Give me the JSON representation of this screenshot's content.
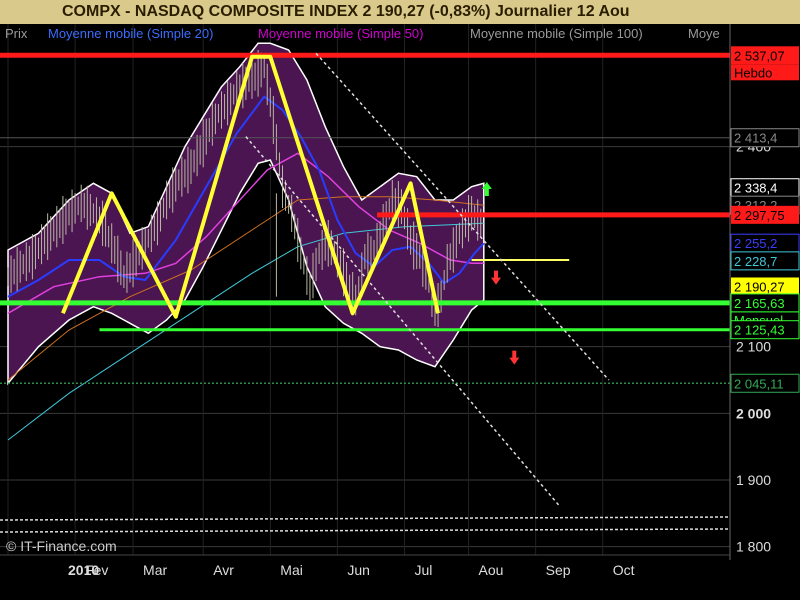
{
  "header": {
    "title": "COMPX - NASDAQ COMPOSITE INDEX    2 190,27 (-0,83%)    Journalier  12 Aou"
  },
  "legend": [
    {
      "text": "Prix",
      "color": "#9a9a9a"
    },
    {
      "text": "Moyenne mobile (Simple 20)",
      "color": "#3a6cff"
    },
    {
      "text": "Moyenne mobile (Simple 50)",
      "color": "#d000d0"
    },
    {
      "text": "Moyenne mobile (Simple 100)",
      "color": "#9a9a9a"
    },
    {
      "text": "Moye",
      "color": "#9a9a9a"
    }
  ],
  "watermark": "© IT-Finance.com",
  "colors": {
    "background": "#000000",
    "band_fill": "#4a1550",
    "zigzag": "#ffff33",
    "resistance": "#ff1a1a",
    "support": "#33ff33",
    "ma20": "#2a3cff",
    "ma50": "#e040e0",
    "ma100": "#d07020",
    "ma200": "#40c8d8",
    "trend_dashed": "#e0e0e0"
  },
  "chart_data": {
    "type": "line",
    "title": "COMPX - NASDAQ COMPOSITE INDEX",
    "ylim": [
      1780,
      2560
    ],
    "x_ticks": [
      "2010",
      "Fev",
      "Mar",
      "Avr",
      "Mai",
      "Jun",
      "Jul",
      "Aou",
      "Sep",
      "Oct"
    ],
    "x_tick_index": [
      0,
      22,
      41,
      64,
      86,
      108,
      130,
      151,
      173,
      195
    ],
    "y_ticks": [
      {
        "value": 2400,
        "label": "2 400"
      },
      {
        "value": 2100,
        "label": "2 100"
      },
      {
        "value": 2000,
        "label": "2 000"
      },
      {
        "value": 1900,
        "label": "1 900"
      },
      {
        "value": 1800,
        "label": "1 800"
      }
    ],
    "hline_labels": [
      {
        "value": 2537.07,
        "label": "2 537,07",
        "color": "#ff1a1a",
        "sub": "Hebdo"
      },
      {
        "value": 2413.4,
        "label": "2 413,4",
        "color": "#888888"
      },
      {
        "value": 2338.4,
        "label": "2 338,4",
        "color": "#ffffff"
      },
      {
        "value": 2312.2,
        "label": "2 312,2",
        "color": "#888888"
      },
      {
        "value": 2297.75,
        "label": "2 297,75",
        "color": "#ff1a1a"
      },
      {
        "value": 2255.2,
        "label": "2 255,2",
        "color": "#3a3cff"
      },
      {
        "value": 2228.7,
        "label": "2 228,7",
        "color": "#40c8d8"
      },
      {
        "value": 2190.27,
        "label": "2 190,27",
        "color": "#ffff00"
      },
      {
        "value": 2165.63,
        "label": "2 165,63",
        "color": "#33ff33",
        "sub": "Mensuel"
      },
      {
        "value": 2125.43,
        "label": "2 125,43",
        "color": "#33ff33"
      },
      {
        "value": 2045.11,
        "label": "2 045,11",
        "color": "#33aa55"
      }
    ],
    "levels": {
      "top_resistance": 2537.07,
      "resistance": 2297.75,
      "support_monthly": 2165.63,
      "support_low": 2125.43,
      "dotted_support": 2045.11,
      "last": 2190.27,
      "ref_2413": 2413.4
    },
    "zigzag": [
      {
        "i": 18,
        "v": 2150
      },
      {
        "i": 34,
        "v": 2330
      },
      {
        "i": 55,
        "v": 2145
      },
      {
        "i": 80,
        "v": 2535
      },
      {
        "i": 86,
        "v": 2535
      },
      {
        "i": 113,
        "v": 2150
      },
      {
        "i": 132,
        "v": 2345
      },
      {
        "i": 141,
        "v": 2150
      }
    ],
    "zigzag_left": [
      {
        "i": 0,
        "v": 2250
      }
    ],
    "trendlines": [
      {
        "from": {
          "i": 101,
          "v": 2540
        },
        "to": {
          "i": 197,
          "v": 2050
        }
      },
      {
        "from": {
          "i": 78,
          "v": 2415
        },
        "to": {
          "i": 181,
          "v": 1860
        }
      }
    ],
    "price": [
      {
        "i": 0,
        "v": 2205
      },
      {
        "i": 4,
        "v": 2220
      },
      {
        "i": 8,
        "v": 2235
      },
      {
        "i": 12,
        "v": 2260
      },
      {
        "i": 16,
        "v": 2280
      },
      {
        "i": 20,
        "v": 2300
      },
      {
        "i": 24,
        "v": 2315
      },
      {
        "i": 27,
        "v": 2305
      },
      {
        "i": 31,
        "v": 2285
      },
      {
        "i": 35,
        "v": 2245
      },
      {
        "i": 38,
        "v": 2205
      },
      {
        "i": 41,
        "v": 2225
      },
      {
        "i": 45,
        "v": 2255
      },
      {
        "i": 49,
        "v": 2285
      },
      {
        "i": 52,
        "v": 2320
      },
      {
        "i": 56,
        "v": 2350
      },
      {
        "i": 60,
        "v": 2370
      },
      {
        "i": 63,
        "v": 2395
      },
      {
        "i": 66,
        "v": 2425
      },
      {
        "i": 69,
        "v": 2450
      },
      {
        "i": 72,
        "v": 2465
      },
      {
        "i": 75,
        "v": 2485
      },
      {
        "i": 78,
        "v": 2495
      },
      {
        "i": 81,
        "v": 2505
      },
      {
        "i": 84,
        "v": 2520
      },
      {
        "i": 87,
        "v": 2440
      },
      {
        "i": 90,
        "v": 2340
      },
      {
        "i": 93,
        "v": 2300
      },
      {
        "i": 96,
        "v": 2240
      },
      {
        "i": 99,
        "v": 2190
      },
      {
        "i": 102,
        "v": 2240
      },
      {
        "i": 105,
        "v": 2255
      },
      {
        "i": 108,
        "v": 2235
      },
      {
        "i": 111,
        "v": 2200
      },
      {
        "i": 114,
        "v": 2170
      },
      {
        "i": 117,
        "v": 2235
      },
      {
        "i": 120,
        "v": 2245
      },
      {
        "i": 123,
        "v": 2280
      },
      {
        "i": 126,
        "v": 2320
      },
      {
        "i": 129,
        "v": 2310
      },
      {
        "i": 132,
        "v": 2260
      },
      {
        "i": 135,
        "v": 2235
      },
      {
        "i": 138,
        "v": 2195
      },
      {
        "i": 140,
        "v": 2150
      },
      {
        "i": 142,
        "v": 2175
      },
      {
        "i": 144,
        "v": 2225
      },
      {
        "i": 146,
        "v": 2245
      },
      {
        "i": 148,
        "v": 2270
      },
      {
        "i": 150,
        "v": 2285
      },
      {
        "i": 152,
        "v": 2300
      },
      {
        "i": 154,
        "v": 2290
      },
      {
        "i": 156,
        "v": 2280
      }
    ],
    "ma20": [
      {
        "i": 0,
        "v": 2175
      },
      {
        "i": 10,
        "v": 2200
      },
      {
        "i": 20,
        "v": 2230
      },
      {
        "i": 30,
        "v": 2230
      },
      {
        "i": 38,
        "v": 2205
      },
      {
        "i": 45,
        "v": 2200
      },
      {
        "i": 55,
        "v": 2260
      },
      {
        "i": 65,
        "v": 2340
      },
      {
        "i": 75,
        "v": 2420
      },
      {
        "i": 84,
        "v": 2475
      },
      {
        "i": 90,
        "v": 2455
      },
      {
        "i": 96,
        "v": 2415
      },
      {
        "i": 102,
        "v": 2365
      },
      {
        "i": 108,
        "v": 2290
      },
      {
        "i": 114,
        "v": 2240
      },
      {
        "i": 120,
        "v": 2220
      },
      {
        "i": 126,
        "v": 2245
      },
      {
        "i": 132,
        "v": 2250
      },
      {
        "i": 138,
        "v": 2225
      },
      {
        "i": 143,
        "v": 2195
      },
      {
        "i": 148,
        "v": 2210
      },
      {
        "i": 153,
        "v": 2240
      },
      {
        "i": 156,
        "v": 2255
      }
    ],
    "ma50": [
      {
        "i": 0,
        "v": 2150
      },
      {
        "i": 15,
        "v": 2190
      },
      {
        "i": 30,
        "v": 2205
      },
      {
        "i": 45,
        "v": 2210
      },
      {
        "i": 55,
        "v": 2225
      },
      {
        "i": 65,
        "v": 2265
      },
      {
        "i": 75,
        "v": 2315
      },
      {
        "i": 85,
        "v": 2365
      },
      {
        "i": 95,
        "v": 2390
      },
      {
        "i": 105,
        "v": 2355
      },
      {
        "i": 115,
        "v": 2310
      },
      {
        "i": 125,
        "v": 2275
      },
      {
        "i": 135,
        "v": 2255
      },
      {
        "i": 145,
        "v": 2230
      },
      {
        "i": 152,
        "v": 2225
      },
      {
        "i": 156,
        "v": 2225
      }
    ],
    "ma100": [
      {
        "i": 0,
        "v": 2050
      },
      {
        "i": 20,
        "v": 2125
      },
      {
        "i": 40,
        "v": 2175
      },
      {
        "i": 60,
        "v": 2215
      },
      {
        "i": 80,
        "v": 2275
      },
      {
        "i": 95,
        "v": 2320
      },
      {
        "i": 110,
        "v": 2325
      },
      {
        "i": 125,
        "v": 2325
      },
      {
        "i": 140,
        "v": 2320
      },
      {
        "i": 156,
        "v": 2312
      }
    ],
    "ma200": [
      {
        "i": 0,
        "v": 1960
      },
      {
        "i": 20,
        "v": 2030
      },
      {
        "i": 40,
        "v": 2090
      },
      {
        "i": 60,
        "v": 2150
      },
      {
        "i": 80,
        "v": 2210
      },
      {
        "i": 95,
        "v": 2250
      },
      {
        "i": 110,
        "v": 2270
      },
      {
        "i": 130,
        "v": 2280
      },
      {
        "i": 156,
        "v": 2285
      }
    ],
    "band_upper": [
      {
        "i": 0,
        "v": 2245
      },
      {
        "i": 10,
        "v": 2270
      },
      {
        "i": 20,
        "v": 2320
      },
      {
        "i": 28,
        "v": 2345
      },
      {
        "i": 34,
        "v": 2330
      },
      {
        "i": 40,
        "v": 2270
      },
      {
        "i": 46,
        "v": 2280
      },
      {
        "i": 52,
        "v": 2340
      },
      {
        "i": 58,
        "v": 2400
      },
      {
        "i": 64,
        "v": 2445
      },
      {
        "i": 70,
        "v": 2490
      },
      {
        "i": 76,
        "v": 2520
      },
      {
        "i": 82,
        "v": 2555
      },
      {
        "i": 86,
        "v": 2555
      },
      {
        "i": 92,
        "v": 2545
      },
      {
        "i": 98,
        "v": 2500
      },
      {
        "i": 104,
        "v": 2430
      },
      {
        "i": 110,
        "v": 2370
      },
      {
        "i": 116,
        "v": 2320
      },
      {
        "i": 122,
        "v": 2340
      },
      {
        "i": 128,
        "v": 2360
      },
      {
        "i": 134,
        "v": 2355
      },
      {
        "i": 140,
        "v": 2320
      },
      {
        "i": 146,
        "v": 2320
      },
      {
        "i": 152,
        "v": 2340
      },
      {
        "i": 156,
        "v": 2345
      }
    ],
    "band_lower": [
      {
        "i": 0,
        "v": 2045
      },
      {
        "i": 10,
        "v": 2100
      },
      {
        "i": 20,
        "v": 2140
      },
      {
        "i": 28,
        "v": 2160
      },
      {
        "i": 34,
        "v": 2150
      },
      {
        "i": 40,
        "v": 2135
      },
      {
        "i": 46,
        "v": 2120
      },
      {
        "i": 52,
        "v": 2140
      },
      {
        "i": 58,
        "v": 2170
      },
      {
        "i": 64,
        "v": 2220
      },
      {
        "i": 70,
        "v": 2275
      },
      {
        "i": 76,
        "v": 2330
      },
      {
        "i": 82,
        "v": 2375
      },
      {
        "i": 86,
        "v": 2380
      },
      {
        "i": 92,
        "v": 2320
      },
      {
        "i": 98,
        "v": 2220
      },
      {
        "i": 104,
        "v": 2160
      },
      {
        "i": 110,
        "v": 2135
      },
      {
        "i": 116,
        "v": 2120
      },
      {
        "i": 122,
        "v": 2100
      },
      {
        "i": 128,
        "v": 2095
      },
      {
        "i": 134,
        "v": 2080
      },
      {
        "i": 140,
        "v": 2070
      },
      {
        "i": 146,
        "v": 2110
      },
      {
        "i": 152,
        "v": 2155
      },
      {
        "i": 156,
        "v": 2170
      }
    ],
    "arrows": [
      {
        "i": 157,
        "v": 2335,
        "dir": "up",
        "color": "#33ff33"
      },
      {
        "i": 160,
        "v": 2205,
        "dir": "down",
        "color": "#ff3333"
      },
      {
        "i": 166,
        "v": 2085,
        "dir": "down",
        "color": "#ff3333"
      }
    ]
  }
}
